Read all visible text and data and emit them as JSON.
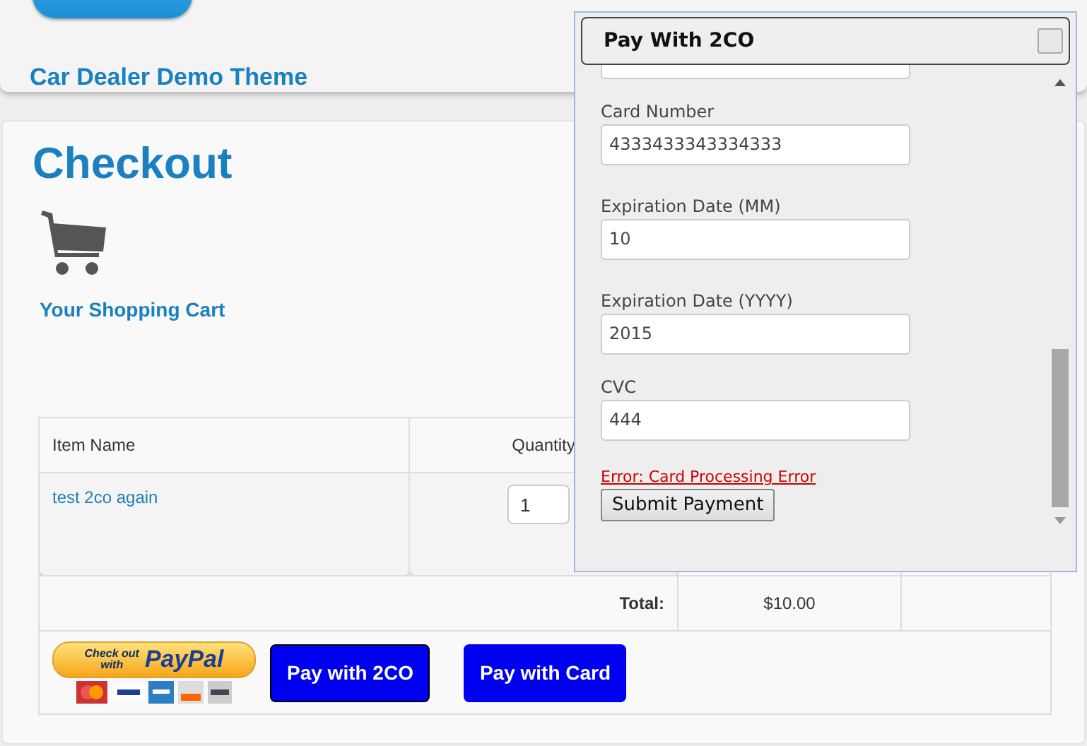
{
  "site": {
    "title": "Car Dealer Demo Theme"
  },
  "page": {
    "heading": "Checkout",
    "cart_label": "Your Shopping Cart"
  },
  "table": {
    "columns": [
      "Item Name",
      "Quantity"
    ],
    "rows": [
      {
        "item": "test 2co again",
        "quantity": "1"
      }
    ],
    "total_label": "Total:",
    "total": "$10.00"
  },
  "payment": {
    "paypal": {
      "line_1": "Check out",
      "line_2": "with",
      "brand": "PayPal"
    },
    "buttons": [
      "Pay with 2CO",
      "Pay with Card"
    ]
  },
  "dialog": {
    "title": "Pay With 2CO",
    "fields": [
      {
        "label": "Card Number",
        "value": "4333433343334333"
      },
      {
        "label": "Expiration Date (MM)",
        "value": "10"
      },
      {
        "label": "Expiration Date (YYYY)",
        "value": "2015"
      },
      {
        "label": "CVC",
        "value": "444"
      }
    ],
    "error": "Error: Card Processing Error",
    "submit": "Submit Payment"
  }
}
